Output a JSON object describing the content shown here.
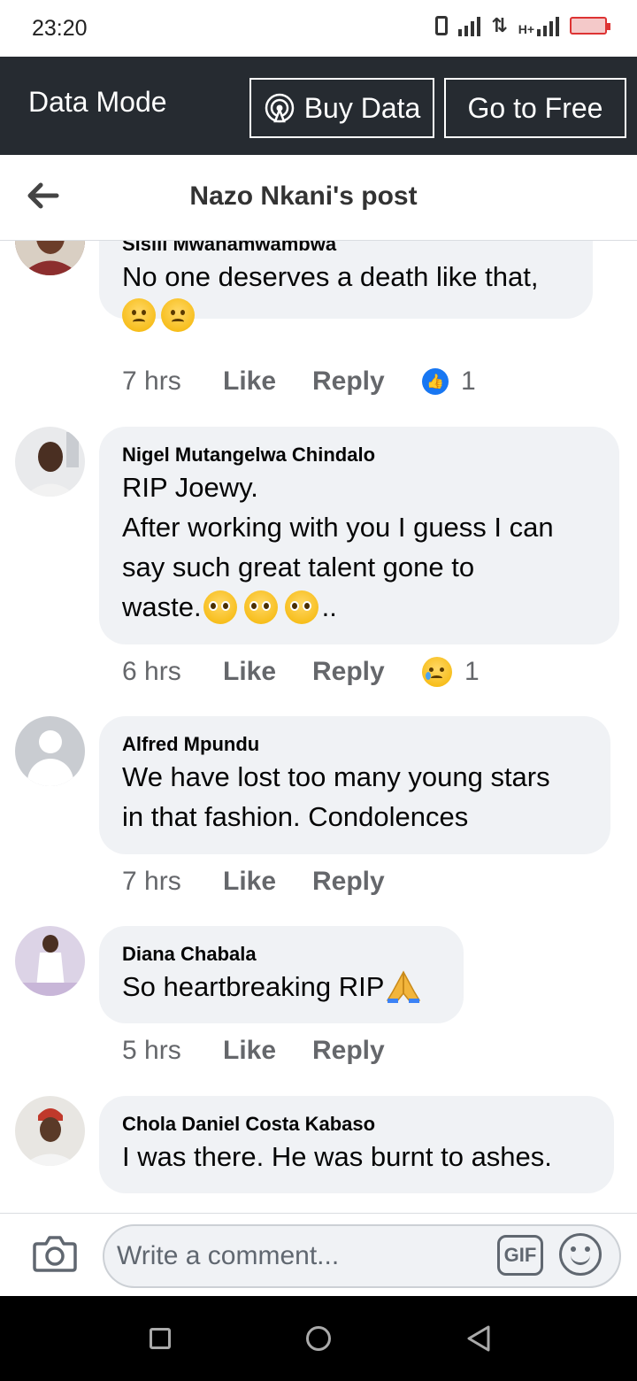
{
  "status_bar": {
    "time": "23:20",
    "network_label": "H+"
  },
  "data_bar": {
    "label": "Data Mode",
    "buy_data": "Buy Data",
    "go_to_free": "Go to Free"
  },
  "header": {
    "title": "Nazo Nkani's post"
  },
  "comments": [
    {
      "author": "Sisili Mwanamwambwa",
      "lines": [
        "No one deserves a death like that,"
      ],
      "emoji": [
        "frowning",
        "frowning"
      ],
      "time": "7 hrs",
      "like": "Like",
      "reply": "Reply",
      "reaction": "like",
      "reaction_count": "1"
    },
    {
      "author": "Nigel Mutangelwa Chindalo",
      "lines": [
        "RIP Joewy.",
        "After working with you I guess I can",
        "say such great talent gone to",
        "waste."
      ],
      "trailing": "..",
      "emoji": [
        "pleading",
        "pleading",
        "pleading"
      ],
      "time": "6 hrs",
      "like": "Like",
      "reply": "Reply",
      "reaction": "sad",
      "reaction_count": "1"
    },
    {
      "author": "Alfred Mpundu",
      "lines": [
        "We have lost too many young stars",
        "in that fashion. Condolences"
      ],
      "time": "7 hrs",
      "like": "Like",
      "reply": "Reply"
    },
    {
      "author": "Diana Chabala",
      "lines": [
        "So heartbreaking RIP"
      ],
      "emoji": [
        "folded-hands"
      ],
      "time": "5 hrs",
      "like": "Like",
      "reply": "Reply"
    },
    {
      "author": "Chola Daniel Costa Kabaso",
      "lines": [
        "I was there. He was burnt to ashes."
      ]
    }
  ],
  "composer": {
    "placeholder": "Write a comment...",
    "gif_label": "GIF"
  },
  "colors": {
    "data_bar_bg": "#262b31",
    "bubble_bg": "#f0f2f5",
    "meta_text": "#65676b",
    "like_blue": "#1877f2"
  }
}
